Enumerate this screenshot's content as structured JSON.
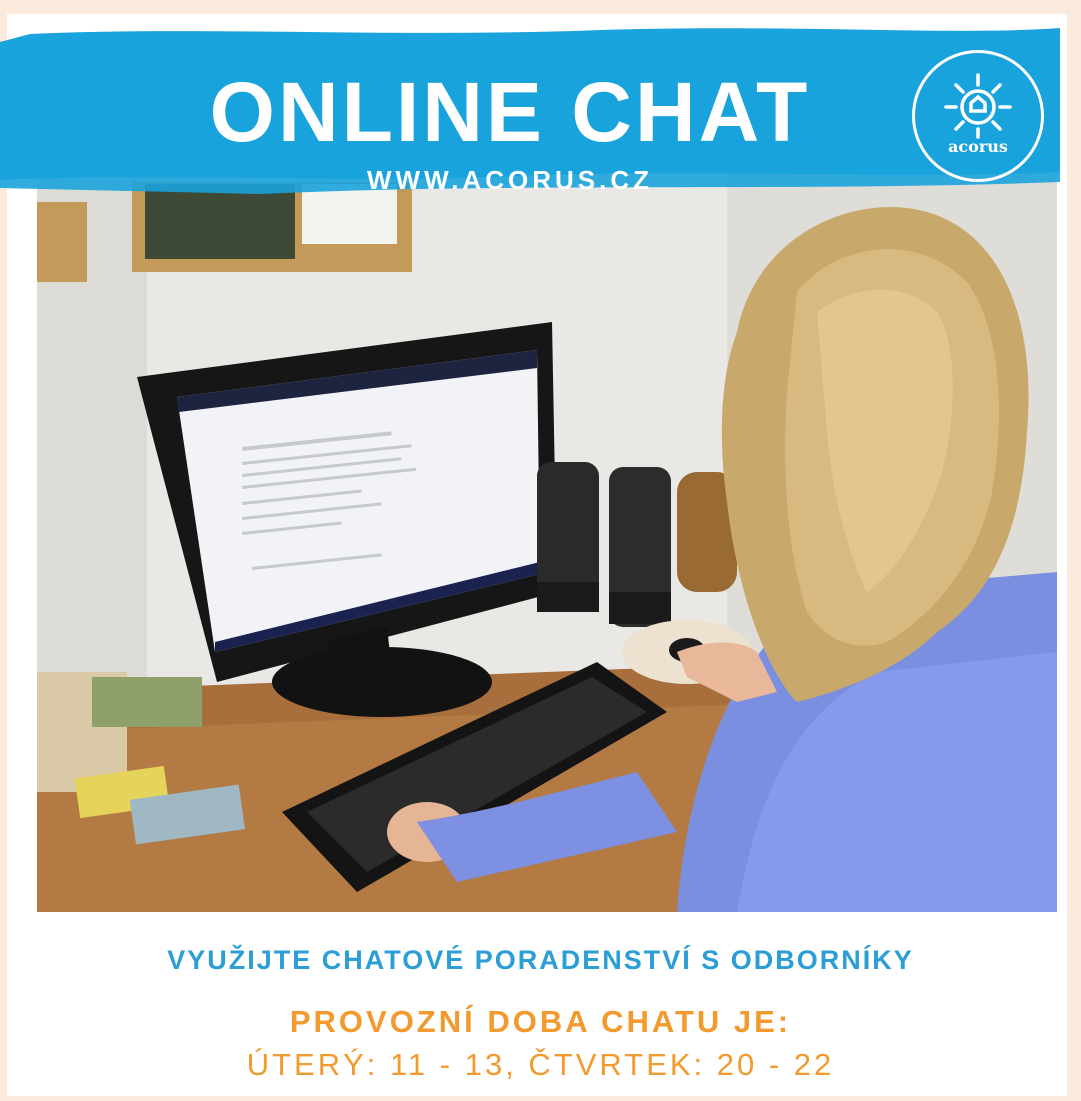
{
  "banner": {
    "title": "ONLINE CHAT",
    "url": "WWW.ACORUS.CZ",
    "color": "#1aa3dc"
  },
  "logo": {
    "icon": "sun-house-icon",
    "text": "acorus"
  },
  "photo": {
    "subject": "woman-at-computer-photo"
  },
  "footer": {
    "line1": "VYUŽIJTE CHATOVÉ PORADENSTVÍ S ODBORNÍKY",
    "line2": "PROVOZNÍ DOBA CHATU JE:",
    "line3": "ÚTERÝ: 11 - 13, ČTVRTEK: 20 - 22",
    "line1_color": "#2b9ed6",
    "accent_color": "#f29a2e"
  }
}
